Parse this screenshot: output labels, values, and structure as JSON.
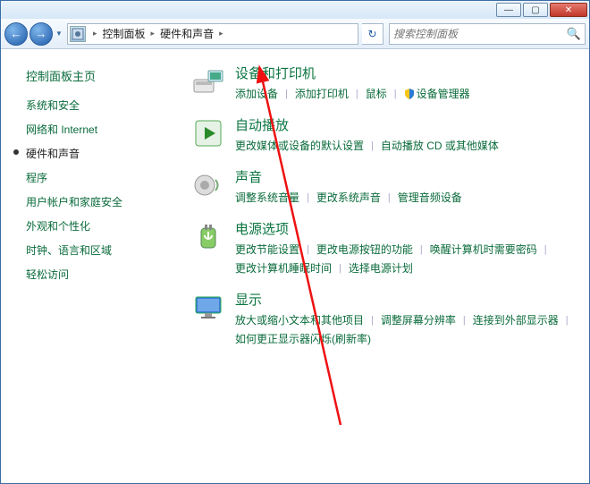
{
  "titlebar": {
    "minimize": "—",
    "maximize": "▢",
    "close": "✕"
  },
  "nav": {
    "back": "←",
    "forward": "→",
    "dropdown": "▼",
    "refresh": "↻"
  },
  "breadcrumb": {
    "root_sep": "▸",
    "item1": "控制面板",
    "item2": "硬件和声音",
    "trail_sep": "▸"
  },
  "search": {
    "placeholder": "搜索控制面板",
    "icon": "🔍"
  },
  "sidebar": {
    "home": "控制面板主页",
    "items": [
      {
        "label": "系统和安全",
        "active": false
      },
      {
        "label": "网络和 Internet",
        "active": false
      },
      {
        "label": "硬件和声音",
        "active": true
      },
      {
        "label": "程序",
        "active": false
      },
      {
        "label": "用户帐户和家庭安全",
        "active": false
      },
      {
        "label": "外观和个性化",
        "active": false
      },
      {
        "label": "时钟、语言和区域",
        "active": false
      },
      {
        "label": "轻松访问",
        "active": false
      }
    ]
  },
  "main": {
    "categories": [
      {
        "icon": "devices",
        "title": "设备和打印机",
        "links": [
          {
            "text": "添加设备",
            "shield": false
          },
          {
            "text": "添加打印机",
            "shield": false
          },
          {
            "text": "鼠标",
            "shield": false
          },
          {
            "text": "设备管理器",
            "shield": true
          }
        ]
      },
      {
        "icon": "autoplay",
        "title": "自动播放",
        "links": [
          {
            "text": "更改媒体或设备的默认设置",
            "shield": false
          },
          {
            "text": "自动播放 CD 或其他媒体",
            "shield": false
          }
        ]
      },
      {
        "icon": "sound",
        "title": "声音",
        "links": [
          {
            "text": "调整系统音量",
            "shield": false
          },
          {
            "text": "更改系统声音",
            "shield": false
          },
          {
            "text": "管理音频设备",
            "shield": false
          }
        ]
      },
      {
        "icon": "power",
        "title": "电源选项",
        "links": [
          {
            "text": "更改节能设置",
            "shield": false
          },
          {
            "text": "更改电源按钮的功能",
            "shield": false
          },
          {
            "text": "唤醒计算机时需要密码",
            "shield": false
          },
          {
            "text": "更改计算机睡眠时间",
            "shield": false
          },
          {
            "text": "选择电源计划",
            "shield": false
          }
        ]
      },
      {
        "icon": "display",
        "title": "显示",
        "links": [
          {
            "text": "放大或缩小文本和其他项目",
            "shield": false
          },
          {
            "text": "调整屏幕分辨率",
            "shield": false
          },
          {
            "text": "连接到外部显示器",
            "shield": false
          },
          {
            "text": "如何更正显示器闪烁(刷新率)",
            "shield": false
          }
        ]
      }
    ]
  }
}
